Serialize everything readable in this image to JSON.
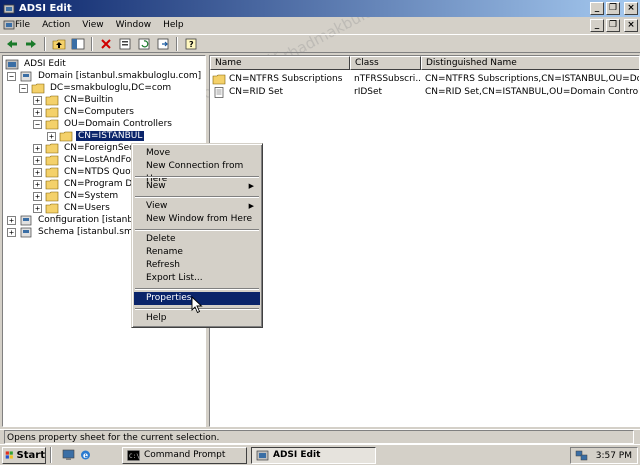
{
  "window": {
    "title": "ADSI Edit"
  },
  "menubar": {
    "items": [
      {
        "label": "File"
      },
      {
        "label": "Action"
      },
      {
        "label": "View"
      },
      {
        "label": "Window"
      },
      {
        "label": "Help"
      }
    ]
  },
  "tree": {
    "root": "ADSI Edit",
    "nodes": [
      {
        "label": "Domain [istanbul.smakbuloglu.com]",
        "expander": "−"
      },
      {
        "label": "DC=smakbuloglu,DC=com",
        "expander": "−"
      },
      {
        "label": "CN=Builtin",
        "expander": "+"
      },
      {
        "label": "CN=Computers",
        "expander": "+"
      },
      {
        "label": "OU=Domain Controllers",
        "expander": "−"
      },
      {
        "label": "CN=ISTANBUL",
        "expander": "+"
      },
      {
        "label": "CN=ForeignSecuri",
        "expander": "+"
      },
      {
        "label": "CN=LostAndFound",
        "expander": "+"
      },
      {
        "label": "CN=NTDS Quotas",
        "expander": "+"
      },
      {
        "label": "CN=Program Data",
        "expander": "+"
      },
      {
        "label": "CN=System",
        "expander": "+"
      },
      {
        "label": "CN=Users",
        "expander": "+"
      },
      {
        "label": "Configuration [istanbul.sm",
        "expander": "+"
      },
      {
        "label": "Schema [istanbul.smakbulo",
        "expander": "+"
      }
    ]
  },
  "list": {
    "columns": [
      "Name",
      "Class",
      "Distinguished Name"
    ],
    "rows": [
      {
        "name": "CN=NTFRS Subscriptions",
        "class": "nTFRSSubscri...",
        "dn": "CN=NTFRS Subscriptions,CN=ISTANBUL,OU=Domain Con"
      },
      {
        "name": "CN=RID Set",
        "class": "rIDSet",
        "dn": "CN=RID Set,CN=ISTANBUL,OU=Domain Controllers,DC"
      }
    ]
  },
  "context_menu": {
    "items": [
      {
        "label": "Move"
      },
      {
        "label": "New Connection from Here"
      },
      {
        "label": "New"
      },
      {
        "label": "View"
      },
      {
        "label": "New Window from Here"
      },
      {
        "label": "Delete"
      },
      {
        "label": "Rename"
      },
      {
        "label": "Refresh"
      },
      {
        "label": "Export List..."
      },
      {
        "label": "Properties"
      },
      {
        "label": "Help"
      }
    ]
  },
  "statusbar": {
    "text": "Opens property sheet for the current selection."
  },
  "taskbar": {
    "start_label": "Start",
    "tasks": [
      {
        "label": "Command Prompt"
      },
      {
        "label": "ADSI Edit"
      }
    ],
    "clock": "3:57 PM"
  },
  "watermark": "www.serhadmakbuloglu.com.tr",
  "colors": {
    "selection": "#0a246a",
    "face": "#d4d0c8",
    "folder": "#f4d16a"
  }
}
